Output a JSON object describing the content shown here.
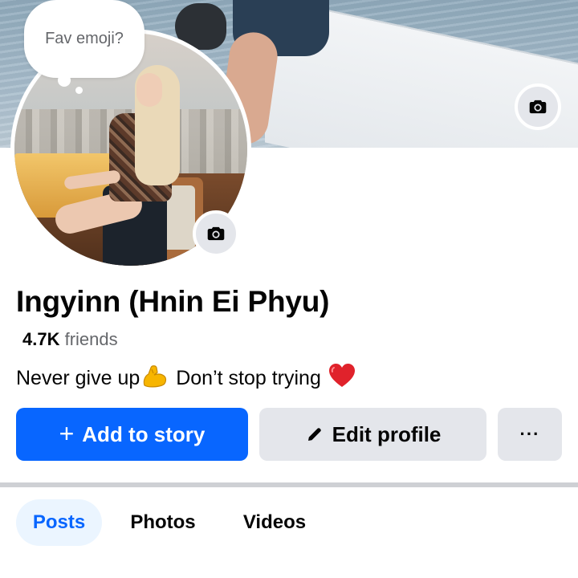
{
  "profile": {
    "note_prompt": "Fav emoji?",
    "name": "Ingyinn (Hnin Ei Phyu)",
    "friends_count": "4.7K",
    "friends_label": "friends",
    "bio_part1": "Never give up",
    "bio_part2": "Don’t stop trying"
  },
  "icons": {
    "cover_camera": "camera-icon",
    "avatar_camera": "camera-icon",
    "bio_emoji_1": "flexed-biceps-icon",
    "bio_emoji_2": "red-heart-icon",
    "edit": "pencil-icon",
    "more": "more-dots-icon"
  },
  "actions": {
    "add_story": "Add to story",
    "edit_profile": "Edit profile",
    "more": "···"
  },
  "tabs": [
    {
      "label": "Posts",
      "active": true
    },
    {
      "label": "Photos",
      "active": false
    },
    {
      "label": "Videos",
      "active": false
    }
  ],
  "colors": {
    "primary": "#0866ff",
    "secondary_bg": "#e4e6eb",
    "active_tab_bg": "#ebf5ff",
    "muted_text": "#65676b"
  }
}
